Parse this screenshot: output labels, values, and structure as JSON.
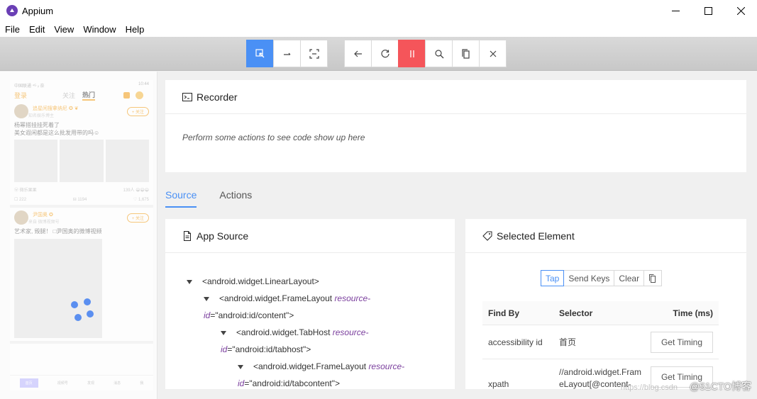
{
  "window": {
    "title": "Appium"
  },
  "menu": [
    "File",
    "Edit",
    "View",
    "Window",
    "Help"
  ],
  "toolbar": {
    "group1": [
      "select-element-icon",
      "swipe-icon",
      "tap-by-coordinates-icon"
    ],
    "group2": [
      "back-icon",
      "refresh-icon",
      "pause-icon",
      "search-icon",
      "copy-xml-icon",
      "close-icon"
    ]
  },
  "device": {
    "status_left": "中国联通 ⁴ᴳ ᵢₗ 奈",
    "status_right": "10:44",
    "tabs": [
      "登录",
      "关注",
      "热门"
    ],
    "post1": {
      "name": "追星闲搜拿纳尼 ✪ ❦",
      "sub": "知名娱乐博主",
      "follow": "+ 关注",
      "text1": "杨幂搭挂挂死着了",
      "text2": "美女遐闲都是这么批发用带的吗☺",
      "source": "ⓦ 微乐果果",
      "likes": "139人 😀😀😀",
      "comments": "☐ 222",
      "reposts": "⊟ 1194",
      "favs": "♡ 1,675"
    },
    "post2": {
      "name": "尹国奥 ✪",
      "sub": "来自 微博视频号",
      "follow": "+ 关注",
      "text": "艺术家, 毁腿！ □尹国奥的微博视频"
    },
    "nav": [
      "首页",
      "视频号",
      "发现",
      "消息",
      "我"
    ]
  },
  "recorder": {
    "title": "Recorder",
    "message": "Perform some actions to see code show up here"
  },
  "tabs": {
    "source": "Source",
    "actions": "Actions"
  },
  "app_source": {
    "title": "App Source",
    "nodes": [
      {
        "tag": "<android.widget.LinearLayout>",
        "attr": "",
        "val": "",
        "close": ""
      },
      {
        "tag": "<android.widget.FrameLayout",
        "attr": "resource-",
        "attr2": "id",
        "val": "=\"android:id/content\"",
        "close": ">"
      },
      {
        "tag": "<android.widget.TabHost",
        "attr": "resource-",
        "attr2": "id",
        "val": "=\"android:id/tabhost\"",
        "close": ">"
      },
      {
        "tag": "<android.widget.FrameLayout",
        "attr": "resource-",
        "attr2": "id",
        "val": "=\"android:id/tabcontent\"",
        "close": ">"
      }
    ]
  },
  "selected_element": {
    "title": "Selected Element",
    "actions": [
      "Tap",
      "Send Keys",
      "Clear"
    ],
    "headers": [
      "Find By",
      "Selector",
      "Time (ms)"
    ],
    "rows": [
      {
        "by": "accessibility id",
        "selector": "首页",
        "timing": "Get Timing"
      },
      {
        "by": "xpath",
        "selector": "//android.widget.FrameLayout[@content-",
        "timing": "Get Timing"
      }
    ]
  },
  "watermark": "@51CTO博客",
  "watermark_faint": "https://blog.csdn"
}
